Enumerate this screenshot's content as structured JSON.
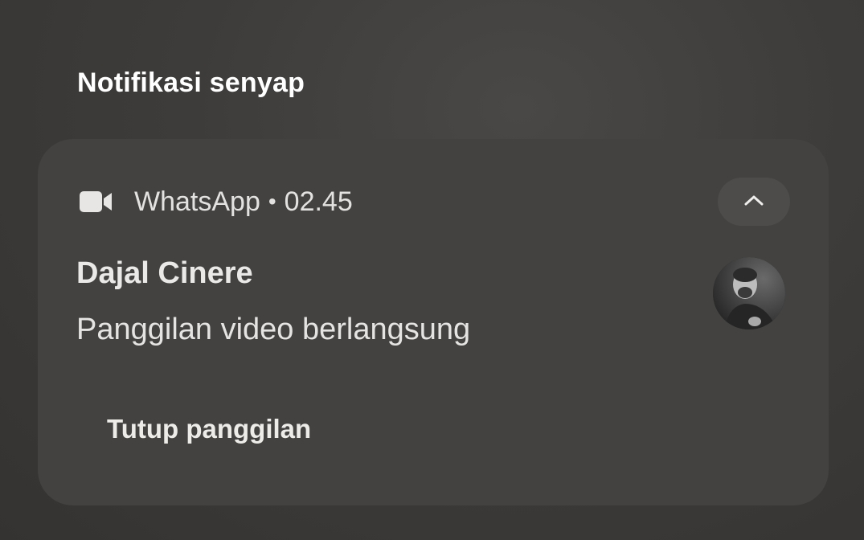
{
  "section": {
    "title": "Notifikasi senyap"
  },
  "notification": {
    "app_icon": "video-camera-icon",
    "app_name": "WhatsApp",
    "separator": "•",
    "time": "02.45",
    "expand_icon": "chevron-up-icon",
    "caller_name": "Dajal Cinere",
    "status": "Panggilan video berlangsung",
    "avatar": "contact-avatar",
    "action_label": "Tutup panggilan"
  },
  "colors": {
    "card_background": "#434241",
    "text_primary": "#ebe9e7",
    "page_background": "#3e3c3a"
  }
}
